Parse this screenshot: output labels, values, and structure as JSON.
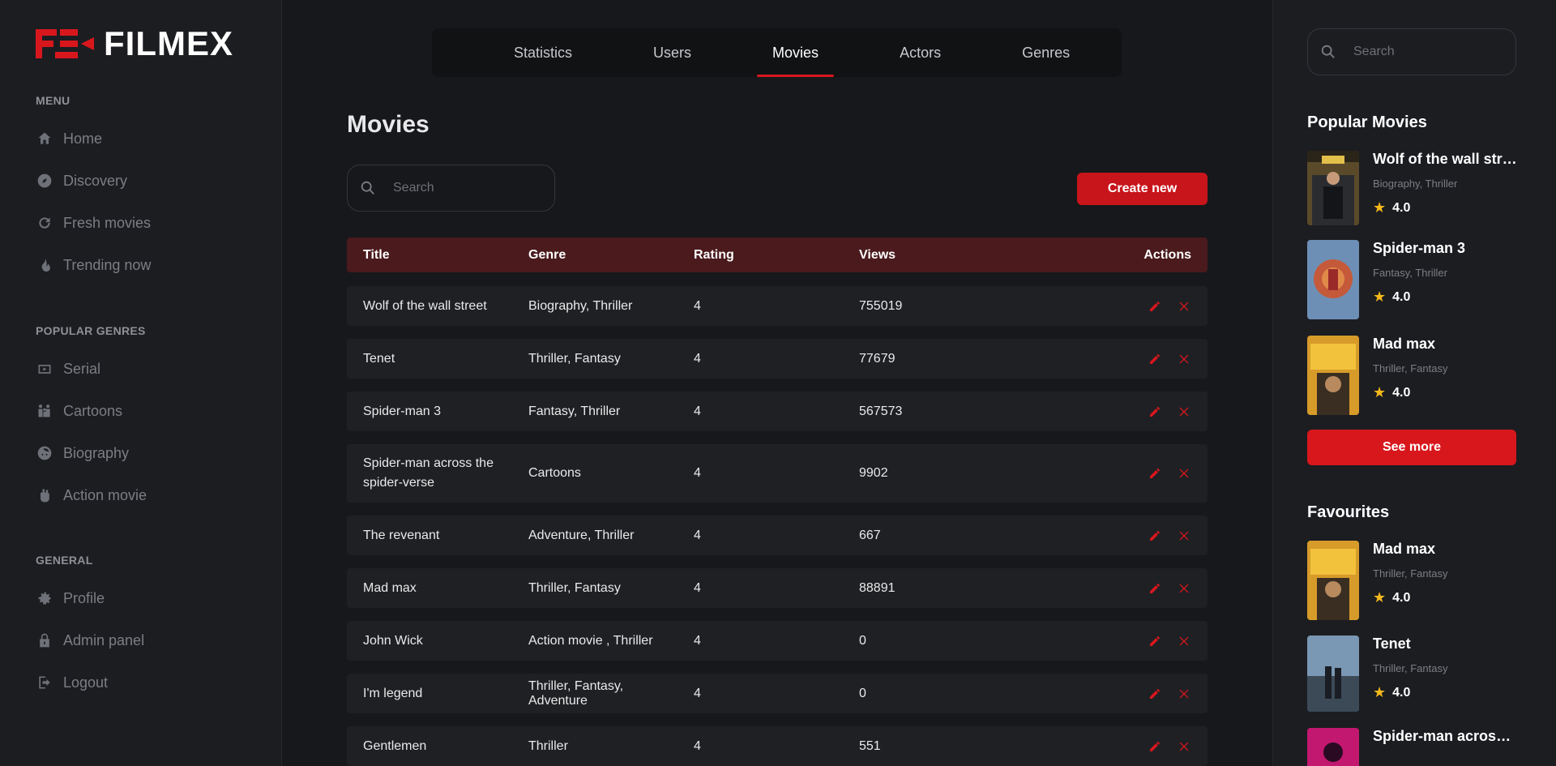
{
  "brand": {
    "name": "FILMEX",
    "accent": "#d8171d"
  },
  "sidebar": {
    "menu_heading": "MENU",
    "menu": [
      {
        "label": "Home",
        "icon": "home-icon"
      },
      {
        "label": "Discovery",
        "icon": "compass-icon"
      },
      {
        "label": "Fresh movies",
        "icon": "refresh-icon"
      },
      {
        "label": "Trending now",
        "icon": "flame-icon"
      }
    ],
    "genres_heading": "POPULAR GENRES",
    "genres": [
      {
        "label": "Serial",
        "icon": "tv-icon"
      },
      {
        "label": "Cartoons",
        "icon": "family-icon"
      },
      {
        "label": "Biography",
        "icon": "face-icon"
      },
      {
        "label": "Action movie",
        "icon": "fist-icon"
      }
    ],
    "general_heading": "GENERAL",
    "general": [
      {
        "label": "Profile",
        "icon": "gear-icon"
      },
      {
        "label": "Admin panel",
        "icon": "lock-icon"
      },
      {
        "label": "Logout",
        "icon": "logout-icon"
      }
    ]
  },
  "topnav": {
    "tabs": [
      "Statistics",
      "Users",
      "Movies",
      "Actors",
      "Genres"
    ],
    "active": "Movies"
  },
  "main": {
    "title": "Movies",
    "search_placeholder": "Search",
    "create_label": "Create new",
    "columns": {
      "title": "Title",
      "genre": "Genre",
      "rating": "Rating",
      "views": "Views",
      "actions": "Actions"
    },
    "rows": [
      {
        "title": "Wolf of the wall street",
        "genre": "Biography, Thriller",
        "rating": "4",
        "views": "755019"
      },
      {
        "title": "Tenet",
        "genre": "Thriller, Fantasy",
        "rating": "4",
        "views": "77679"
      },
      {
        "title": "Spider-man 3",
        "genre": "Fantasy, Thriller",
        "rating": "4",
        "views": "567573"
      },
      {
        "title": "Spider-man across the spider-verse",
        "genre": "Cartoons",
        "rating": "4",
        "views": "9902"
      },
      {
        "title": "The revenant",
        "genre": "Adventure, Thriller",
        "rating": "4",
        "views": "667"
      },
      {
        "title": "Mad max",
        "genre": "Thriller, Fantasy",
        "rating": "4",
        "views": "88891"
      },
      {
        "title": "John Wick",
        "genre": "Action movie , Thriller",
        "rating": "4",
        "views": "0"
      },
      {
        "title": "I'm legend",
        "genre": "Thriller, Fantasy, Adventure",
        "rating": "4",
        "views": "0"
      },
      {
        "title": "Gentlemen",
        "genre": "Thriller",
        "rating": "4",
        "views": "551"
      }
    ]
  },
  "right": {
    "search_placeholder": "Search",
    "popular_title": "Popular Movies",
    "popular": [
      {
        "title": "Wolf of the wall stre...",
        "genre": "Biography, Thriller",
        "rating": "4.0"
      },
      {
        "title": "Spider-man 3",
        "genre": "Fantasy, Thriller",
        "rating": "4.0"
      },
      {
        "title": "Mad max",
        "genre": "Thriller, Fantasy",
        "rating": "4.0"
      }
    ],
    "see_more_label": "See more",
    "favourites_title": "Favourites",
    "favourites": [
      {
        "title": "Mad max",
        "genre": "Thriller, Fantasy",
        "rating": "4.0"
      },
      {
        "title": "Tenet",
        "genre": "Thriller, Fantasy",
        "rating": "4.0"
      },
      {
        "title": "Spider-man across ..."
      }
    ]
  }
}
